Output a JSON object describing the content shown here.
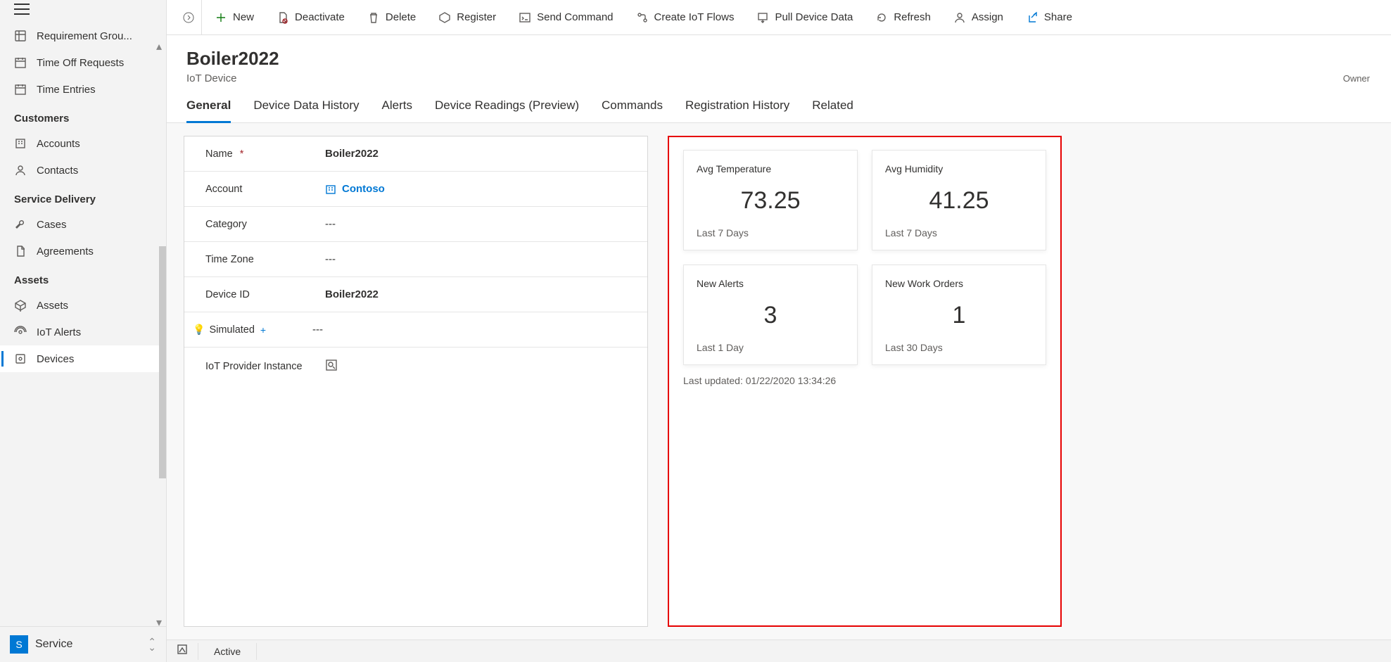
{
  "sidebar": {
    "top_items": [
      {
        "label": "Requirement Grou..."
      },
      {
        "label": "Time Off Requests"
      },
      {
        "label": "Time Entries"
      }
    ],
    "sections": [
      {
        "title": "Customers",
        "items": [
          {
            "label": "Accounts"
          },
          {
            "label": "Contacts"
          }
        ]
      },
      {
        "title": "Service Delivery",
        "items": [
          {
            "label": "Cases"
          },
          {
            "label": "Agreements"
          }
        ]
      },
      {
        "title": "Assets",
        "items": [
          {
            "label": "Assets"
          },
          {
            "label": "IoT Alerts"
          },
          {
            "label": "Devices",
            "active": true
          }
        ]
      }
    ],
    "footer_badge": "S",
    "footer_label": "Service"
  },
  "toolbar": [
    {
      "label": "New"
    },
    {
      "label": "Deactivate"
    },
    {
      "label": "Delete"
    },
    {
      "label": "Register"
    },
    {
      "label": "Send Command"
    },
    {
      "label": "Create IoT Flows"
    },
    {
      "label": "Pull Device Data"
    },
    {
      "label": "Refresh"
    },
    {
      "label": "Assign"
    },
    {
      "label": "Share"
    }
  ],
  "header": {
    "title": "Boiler2022",
    "subtitle": "IoT Device",
    "owner": "Owner"
  },
  "tabs": [
    {
      "label": "General",
      "active": true
    },
    {
      "label": "Device Data History"
    },
    {
      "label": "Alerts"
    },
    {
      "label": "Device Readings (Preview)"
    },
    {
      "label": "Commands"
    },
    {
      "label": "Registration History"
    },
    {
      "label": "Related"
    }
  ],
  "form": {
    "name_label": "Name",
    "name_value": "Boiler2022",
    "account_label": "Account",
    "account_value": "Contoso",
    "category_label": "Category",
    "category_value": "---",
    "timezone_label": "Time Zone",
    "timezone_value": "---",
    "deviceid_label": "Device ID",
    "deviceid_value": "Boiler2022",
    "simulated_label": "Simulated",
    "simulated_value": "---",
    "provider_label": "IoT Provider Instance"
  },
  "summary": {
    "cards": [
      {
        "title": "Avg Temperature",
        "value": "73.25",
        "sub": "Last 7 Days"
      },
      {
        "title": "Avg Humidity",
        "value": "41.25",
        "sub": "Last 7 Days"
      },
      {
        "title": "New Alerts",
        "value": "3",
        "sub": "Last 1 Day"
      },
      {
        "title": "New Work Orders",
        "value": "1",
        "sub": "Last 30 Days"
      }
    ],
    "last_updated": "Last updated: 01/22/2020 13:34:26"
  },
  "status": "Active"
}
